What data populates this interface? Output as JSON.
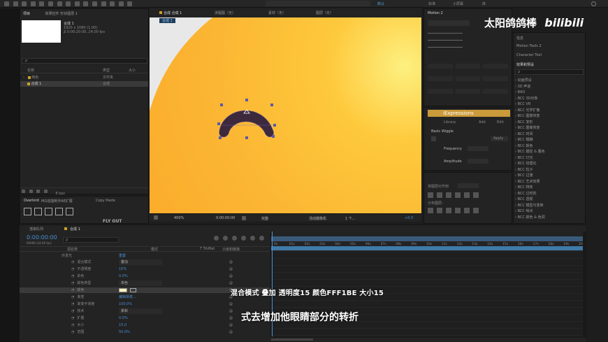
{
  "app": {
    "workspaces": [
      "标准",
      "小屏幕",
      "库"
    ],
    "active_workspace": "默认"
  },
  "project_panel": {
    "tab_label": "项目",
    "effects_tab": "效果控件 形状图层 1",
    "comp_name": "合成 1",
    "comp_info1": "1920 x 1080 (1.00)",
    "comp_info2": "Δ 0:00:20:00, 24.00 fps",
    "search_placeholder": "ρ",
    "col_name": "名称",
    "col_type": "类型",
    "col_size": "大小",
    "items": [
      {
        "name": "纯色",
        "type": "文件夹",
        "color": "#c9a227"
      },
      {
        "name": "合成 1",
        "type": "合成",
        "color": "#c9a227"
      }
    ],
    "bpc": "8 bpc"
  },
  "overlord_panel": {
    "tab_label": "Overlord",
    "tab2": "MG动能制作AE扩展",
    "tab3": "Copy Paste",
    "fly_out": "FLY OUT"
  },
  "viewer": {
    "tabs": [
      "合成 合成 1",
      "流程图（无）",
      "素材（无）",
      "图层（无）"
    ],
    "sub_tab": "合成 1",
    "zoom": "400%",
    "timecode": "0:00:00:00",
    "quality": "完整",
    "camera": "活动摄像机",
    "views": "1 个...",
    "exposure": "+0.0",
    "ball_color": "#fbb633",
    "shape_color": "#3c2a3c"
  },
  "right_panel": {
    "motion_tab": "Motion 2",
    "expressions_label": "iExpressions",
    "expressions_sub": [
      "Library",
      "Add",
      "Edit"
    ],
    "wiggle_title": "Basic Wiggle",
    "frequency_label": "Frequency",
    "amplitude_label": "Amplitude",
    "apply_label": "Apply",
    "align_label": "将图层对齐到",
    "distribute_label": "分布图层：",
    "info_tab1": "信息",
    "info_tab2": "Motion Tools 2",
    "char_tab": "Character Tool",
    "effects_tab": "效果和预设",
    "effect_search": "ρ",
    "effects": [
      "动画预设",
      "3D 声道",
      "BAO",
      "BCC 3D对象",
      "BCC VR",
      "BCC 光学扩散",
      "BCC 图像恢复",
      "BCC 变形",
      "BCC 图像恢复",
      "BCC 时间",
      "BCC 模糊",
      "BCC 颜色",
      "BCC 键控 & 叠色",
      "BCC 灯光",
      "BCC 纹理化",
      "BCC 粒子",
      "BCC 过渡",
      "BCC 艺术效果",
      "BCC 特效",
      "BCC 过时的",
      "BCC 透视",
      "BCC 模型与变换",
      "BCC 噪点",
      "BCC 颜色 & 色调"
    ]
  },
  "timeline": {
    "tabs": [
      "渲染队列",
      "合成 1"
    ],
    "timecode": "0:00:00:00",
    "frames": "00000 (24.00 fps)",
    "search_placeholder": "ρ",
    "col_source": "源名称",
    "col_mode": "模式",
    "col_trkmat": "T TrkMat",
    "col_parent": "父级和链接",
    "ruler": [
      "0s",
      "01s",
      "02s",
      "03s",
      "04s",
      "05s",
      "06s",
      "07s",
      "08s",
      "09s",
      "10s",
      "11s",
      "12s",
      "13s",
      "14s",
      "15s",
      "16s",
      "17s",
      "18s",
      "19s",
      "20s"
    ],
    "layer_name": "外发光",
    "layer_reset": "重置",
    "props": [
      {
        "name": "混合模式",
        "value": "叠加",
        "dropdown": true
      },
      {
        "name": "不透明度",
        "value": "15%"
      },
      {
        "name": "杂色",
        "value": "0.0%"
      },
      {
        "name": "颜色类型",
        "value": "单色",
        "dropdown": true
      },
      {
        "name": "颜色",
        "value": "",
        "swatch": "#fff1be",
        "highlight": true
      },
      {
        "name": "渐变",
        "value": "编辑渐变..."
      },
      {
        "name": "渐变平滑度",
        "value": "100.0%"
      },
      {
        "name": "技术",
        "value": "柔和",
        "dropdown": true
      },
      {
        "name": "扩展",
        "value": "0.0%"
      },
      {
        "name": "大小",
        "value": "15.0"
      },
      {
        "name": "范围",
        "value": "50.0%"
      }
    ]
  },
  "captions": {
    "line1": "混合模式 叠加  透明度15  颜色FFF1BE  大小15",
    "line2": "式去增加他眼睛部分的转折"
  },
  "watermark": {
    "text": "太阳鸽鸽棒",
    "logo": "bilibili"
  }
}
